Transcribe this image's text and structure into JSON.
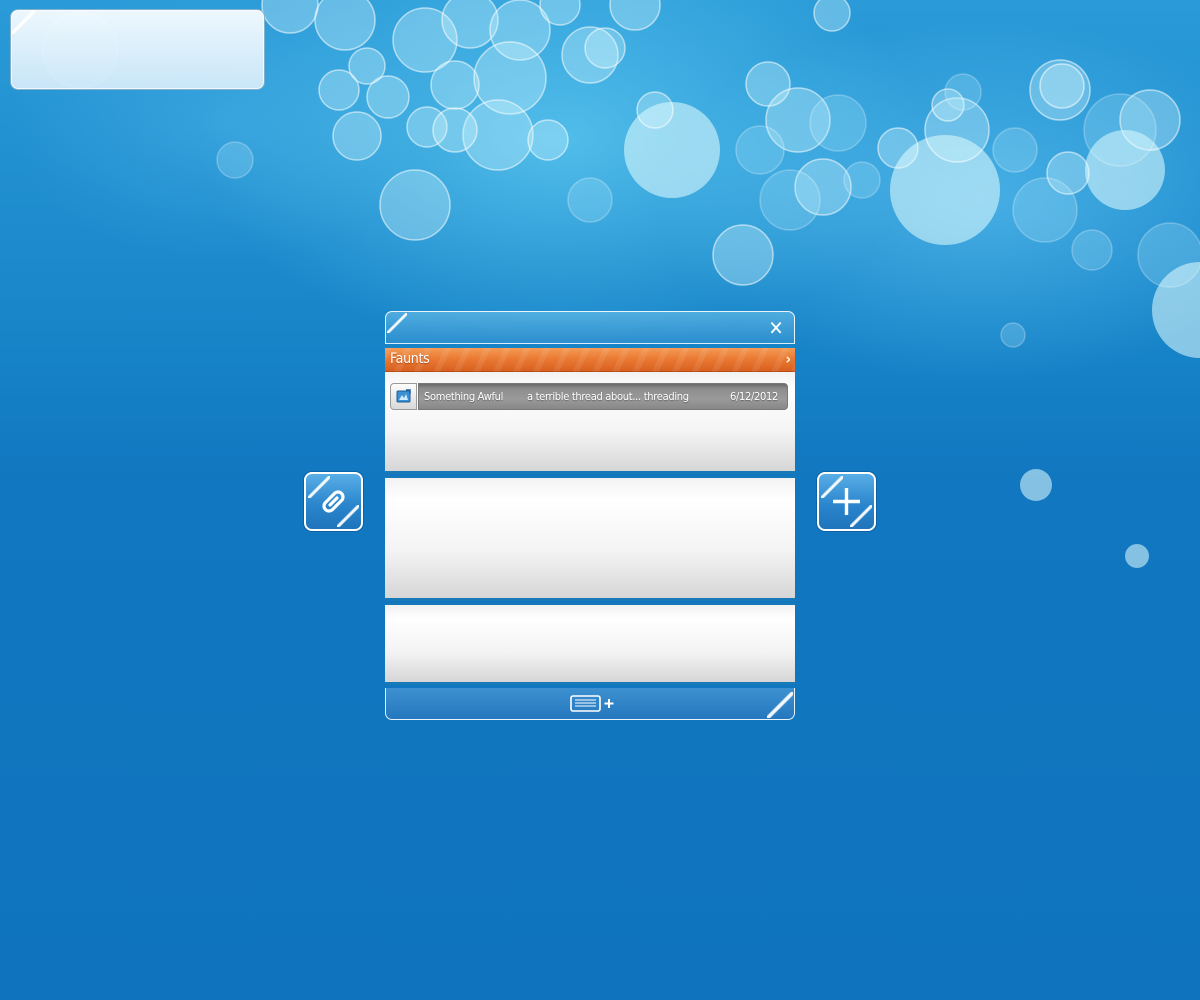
{
  "info_panel": {},
  "window": {
    "close_glyph": "✕",
    "group": {
      "title": "Faunts",
      "chevron": "›"
    },
    "feeds": [
      {
        "icon": "rss-feed-icon",
        "source": "Something Awful",
        "title": "a terrible thread about... threading",
        "date": "6/12/2012"
      }
    ],
    "bottom_bar": {
      "add_icon": "add-feed-icon"
    }
  },
  "side_buttons": {
    "left_icon": "link-icon",
    "right_icon": "plus-icon"
  },
  "colors": {
    "background": "#0f74bd",
    "group_header": "#ea7a33",
    "feed_bar": "#8c8c8c",
    "divider": "#1779b8"
  }
}
